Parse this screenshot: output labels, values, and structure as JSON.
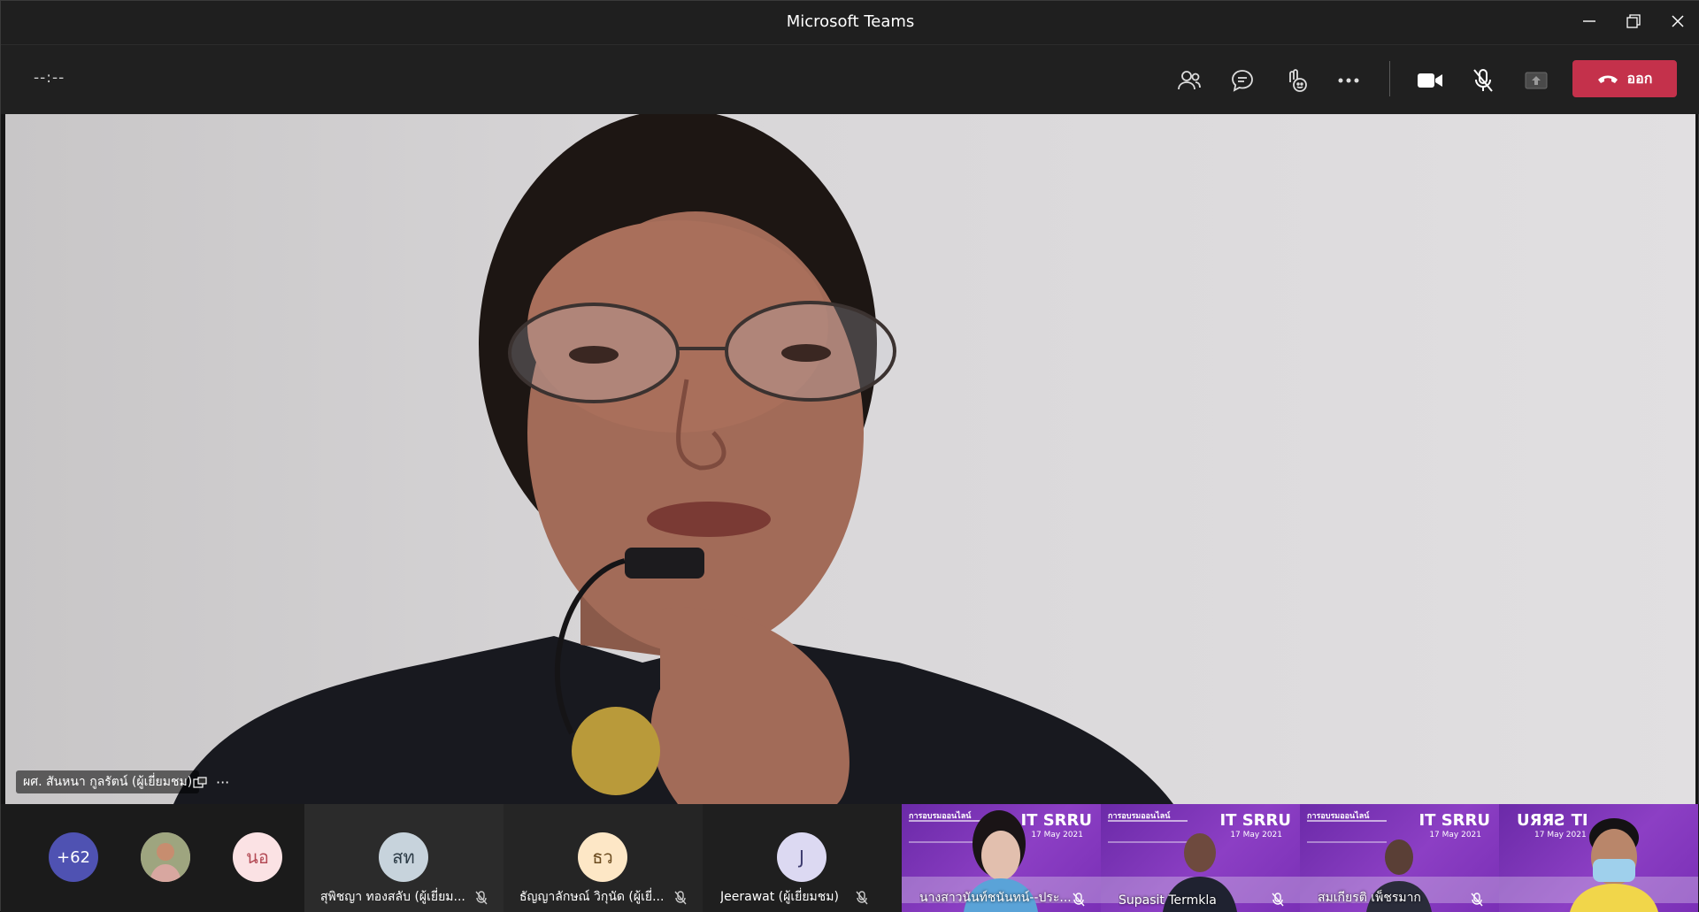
{
  "window": {
    "title": "Microsoft Teams"
  },
  "meeting": {
    "timer": "--:--",
    "leave_label": "ออก",
    "icons": [
      "participants-icon",
      "chat-icon",
      "reactions-icon",
      "more-icon",
      "camera-icon",
      "mic-off-icon",
      "share-icon",
      "phone-hangup-icon"
    ]
  },
  "main_video": {
    "speaker_name": "ผศ. สันหนา กูลรัตน์ (ผู้เยี่ยมชม)",
    "more_label": "···"
  },
  "strip": {
    "overflow_count": "+62",
    "avatar_initials": "นอ",
    "participants": [
      {
        "initials": "สท",
        "name": "สุพิชญา ทองสลับ (ผู้เยี่ยม...",
        "color": "#c7d3dc"
      },
      {
        "initials": "ธว",
        "name": "ธัญญาลักษณ์ วิกุนัด (ผู้เยี่...",
        "color": "#fde7c6"
      },
      {
        "initials": "J",
        "name": "Jeerawat (ผู้เยี่ยมชม)",
        "color": "#dcd9f2"
      }
    ],
    "video_tiles": [
      {
        "name": "นางสาวนันท์ชนันทน์--ประ...",
        "brand": "IT SRRU",
        "date": "17 May 2021",
        "headline": "การอบรมออนไลน์"
      },
      {
        "name": "Supasit Termkla",
        "brand": "IT SRRU",
        "date": "17 May 2021",
        "headline": "การอบรมออนไลน์"
      },
      {
        "name": "สมเกียรติ เพ็ชรมาก",
        "brand": "IT SRRU",
        "date": "17 May 2021",
        "headline": "การอบรมออนไลน์"
      },
      {
        "name": "",
        "brand": "UЯЯƧ TI",
        "date": "17 May 2021",
        "headline": ""
      }
    ]
  }
}
